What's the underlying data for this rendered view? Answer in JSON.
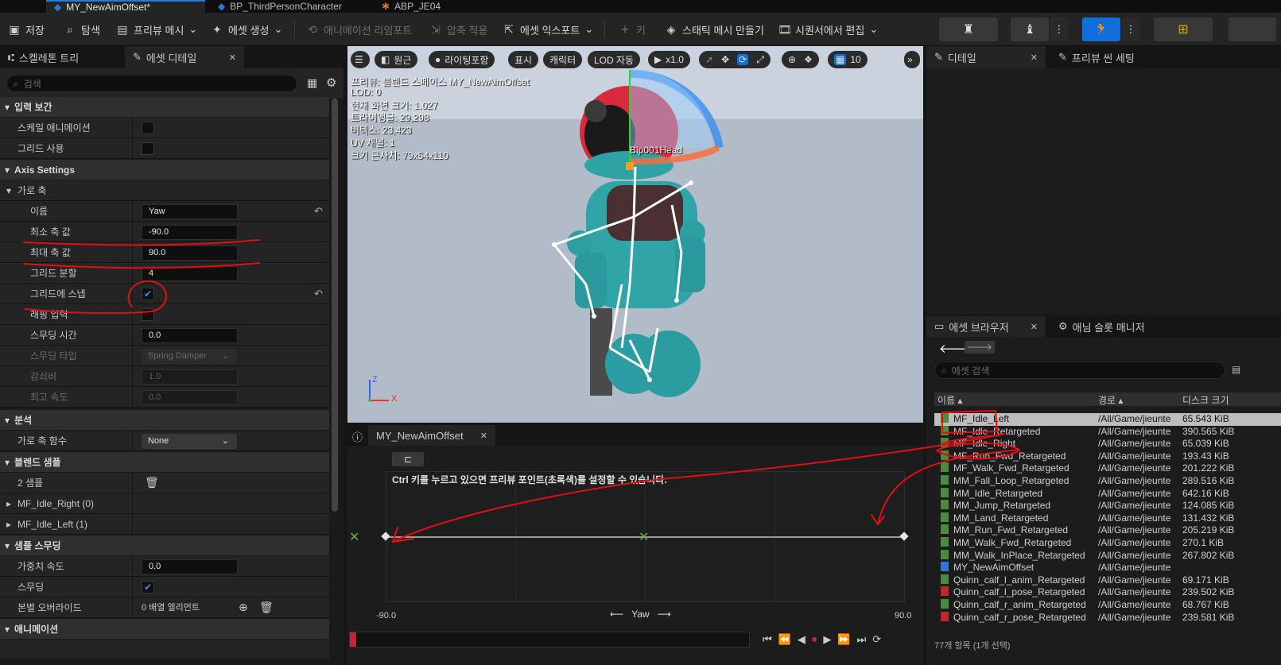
{
  "doc_tabs": [
    "MY_NewAimOffset*",
    "BP_ThirdPersonCharacter",
    "ABP_JE04"
  ],
  "toolbar": {
    "save": "저장",
    "browse": "탐색",
    "preview_mesh": "프리뷰 메시",
    "create_asset": "에셋 생성",
    "reimport": "애니메이션 리임포트",
    "apply_compression": "압축 적용",
    "export_asset": "에셋 익스포트",
    "key": "키",
    "make_static_mesh": "스태틱 메시 만들기",
    "edit_in_sequencer": "시퀀서에서 편집"
  },
  "left_panel": {
    "tabs": [
      "스켈레톤 트리",
      "에셋 디테일"
    ],
    "search_placeholder": "검색",
    "categories": {
      "interp": "입력 보간",
      "axis": "Axis Settings",
      "h_axis": "가로 축",
      "analysis": "분석",
      "blend_samples": "블렌드 샘플",
      "sample_smoothing": "샘플 스무딩",
      "animation": "애니메이션"
    },
    "rows": {
      "scale_anim": "스케일 애니메이션",
      "use_grid": "그리드 사용",
      "name_label": "이름",
      "name_value": "Yaw",
      "min_label": "최소 축 값",
      "min_value": "-90.0",
      "max_label": "최대 축 값",
      "max_value": "90.0",
      "div_label": "그리드 분할",
      "div_value": "4",
      "snap_label": "그리드에 스냅",
      "wrap_label": "래핑 입력",
      "smooth_time_label": "스무딩 시간",
      "smooth_time_value": "0.0",
      "smooth_type_label": "스무딩 타입",
      "smooth_type_value": "Spring Damper",
      "damping_label": "감쇠비",
      "damping_value": "1.0",
      "max_speed_label": "최고 속도",
      "max_speed_value": "0.0",
      "h_func_label": "가로 축 함수",
      "h_func_value": "None",
      "samples_count": "2 샘플",
      "sample_right": "MF_Idle_Right (0)",
      "sample_left": "MF_Idle_Left (1)",
      "weight_speed_label": "가중치 속도",
      "weight_speed_value": "0.0",
      "smoothing_label": "스무딩",
      "bone_override_label": "본별 오버라이드",
      "bone_override_value": "0 배열 엘리먼트"
    }
  },
  "viewport": {
    "pills": [
      "원근",
      "라이팅포함",
      "표시",
      "캐릭터",
      "LOD 자동",
      "x1.0",
      "10"
    ],
    "stats": [
      "프리뷰: 블렌드 스페이스 MY_NewAimOffset",
      "LOD: 0",
      "현재 화면 크기: 1.027",
      "트라이앵글: 29,298",
      "버텍스: 23,423",
      "UV 채널: 1",
      "크기 근사치: 79x54x110"
    ],
    "bone_label": "Bip001Head",
    "axis_z": "Z",
    "axis_x": "X"
  },
  "blendspace": {
    "tab": "MY_NewAimOffset",
    "hint": "Ctrl 키를 누르고 있으면 프리뷰 포인트(초록색)를 설정할 수 있습니다.",
    "min": "-90.0",
    "max": "90.0",
    "axis_name": "Yaw"
  },
  "right_top": {
    "tabs": [
      "디테일",
      "프리뷰 씬 세팅"
    ]
  },
  "asset_browser": {
    "tabs": [
      "에셋 브라우저",
      "애님 슬롯 매니저"
    ],
    "search_placeholder": "에셋 검색",
    "columns": [
      "이름",
      "경로",
      "디스크 크기"
    ],
    "footer": "77개 항목 (1개 선택)",
    "rows": [
      {
        "name": "MF_Idle_Left",
        "path": "/All/Game/jieunte",
        "size": "65.543 KiB",
        "type": "anim"
      },
      {
        "name": "MF_Idle_Retargeted",
        "path": "/All/Game/jieunte",
        "size": "390.565 KiB",
        "type": "anim"
      },
      {
        "name": "MF_Idle_Right",
        "path": "/All/Game/jieunte",
        "size": "65.039 KiB",
        "type": "anim"
      },
      {
        "name": "MF_Run_Fwd_Retargeted",
        "path": "/All/Game/jieunte",
        "size": "193.43 KiB",
        "type": "anim"
      },
      {
        "name": "MF_Walk_Fwd_Retargeted",
        "path": "/All/Game/jieunte",
        "size": "201.222 KiB",
        "type": "anim"
      },
      {
        "name": "MM_Fall_Loop_Retargeted",
        "path": "/All/Game/jieunte",
        "size": "289.516 KiB",
        "type": "anim"
      },
      {
        "name": "MM_Idle_Retargeted",
        "path": "/All/Game/jieunte",
        "size": "642.16 KiB",
        "type": "anim"
      },
      {
        "name": "MM_Jump_Retargeted",
        "path": "/All/Game/jieunte",
        "size": "124.085 KiB",
        "type": "anim"
      },
      {
        "name": "MM_Land_Retargeted",
        "path": "/All/Game/jieunte",
        "size": "131.432 KiB",
        "type": "anim"
      },
      {
        "name": "MM_Run_Fwd_Retargeted",
        "path": "/All/Game/jieunte",
        "size": "205.219 KiB",
        "type": "anim"
      },
      {
        "name": "MM_Walk_Fwd_Retargeted",
        "path": "/All/Game/jieunte",
        "size": "270.1 KiB",
        "type": "anim"
      },
      {
        "name": "MM_Walk_InPlace_Retargeted",
        "path": "/All/Game/jieunte",
        "size": "267.802 KiB",
        "type": "anim"
      },
      {
        "name": "MY_NewAimOffset",
        "path": "/All/Game/jieunte",
        "size": "",
        "type": "blend"
      },
      {
        "name": "Quinn_calf_l_anim_Retargeted",
        "path": "/All/Game/jieunte",
        "size": "69.171 KiB",
        "type": "anim"
      },
      {
        "name": "Quinn_calf_l_pose_Retargeted",
        "path": "/All/Game/jieunte",
        "size": "239.502 KiB",
        "type": "pose"
      },
      {
        "name": "Quinn_calf_r_anim_Retargeted",
        "path": "/All/Game/jieunte",
        "size": "68.767 KiB",
        "type": "anim"
      },
      {
        "name": "Quinn_calf_r_pose_Retargeted",
        "path": "/All/Game/jieunte",
        "size": "239.581 KiB",
        "type": "pose"
      }
    ]
  },
  "colors": {
    "accent": "#2b7bd6",
    "anim_icon": "#4c8a3c",
    "pose_icon": "#c0282d",
    "annotation": "#e01010"
  }
}
